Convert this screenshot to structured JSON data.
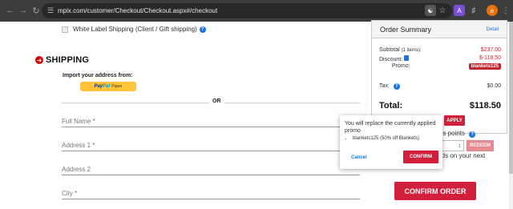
{
  "browser": {
    "url": "mpix.com/customer/Checkout/Checkout.aspx#/checkout",
    "nav_icons": [
      "back-icon",
      "forward-icon",
      "reload-icon"
    ],
    "ext_icons": [
      "translate-icon",
      "star-icon",
      "extension-a-icon",
      "puzzle-icon",
      "profile-avatar",
      "menu-dots-icon"
    ],
    "profile_initial": "e"
  },
  "shipping": {
    "white_label_text": "White Label Shipping (Client / Gift shipping)",
    "section_title": "SHIPPING",
    "import_label": "Import your address from:",
    "paypal_label_a": "Pay",
    "paypal_label_b": "Pal",
    "paypal_suffix": "Paper",
    "or_text": "OR",
    "fields": {
      "full_name": "Full Name *",
      "address1": "Address 1 *",
      "address2": "Address 2",
      "city": "City *"
    }
  },
  "summary": {
    "title": "Order Summary",
    "detail_link": "Detail",
    "subtotal_label": "Subtotal",
    "subtotal_items": "(1 items):",
    "subtotal_value": "$237.00",
    "discount_label": "Discount:",
    "discount_value": "$-118.50",
    "promo_label": "Promo:",
    "promo_code": "blankets125",
    "tax_label": "Tax:",
    "tax_value": "$0.00",
    "total_label": "Total:",
    "total_value": "$118.50",
    "apply_label": "APPLY",
    "points_text": "ds points",
    "stepper_value": "",
    "redeem_label": "REDEEM",
    "next_text": "rds on your next"
  },
  "popover": {
    "message": "You will replace the currently applied promo",
    "item": "blankets125 (50% off Blankets)",
    "cancel_label": "Cancel",
    "confirm_label": "CONFIRM"
  },
  "confirm_order_label": "CONFIRM ORDER",
  "colors": {
    "accent_red": "#d21f3c",
    "link_blue": "#1a73e8"
  }
}
